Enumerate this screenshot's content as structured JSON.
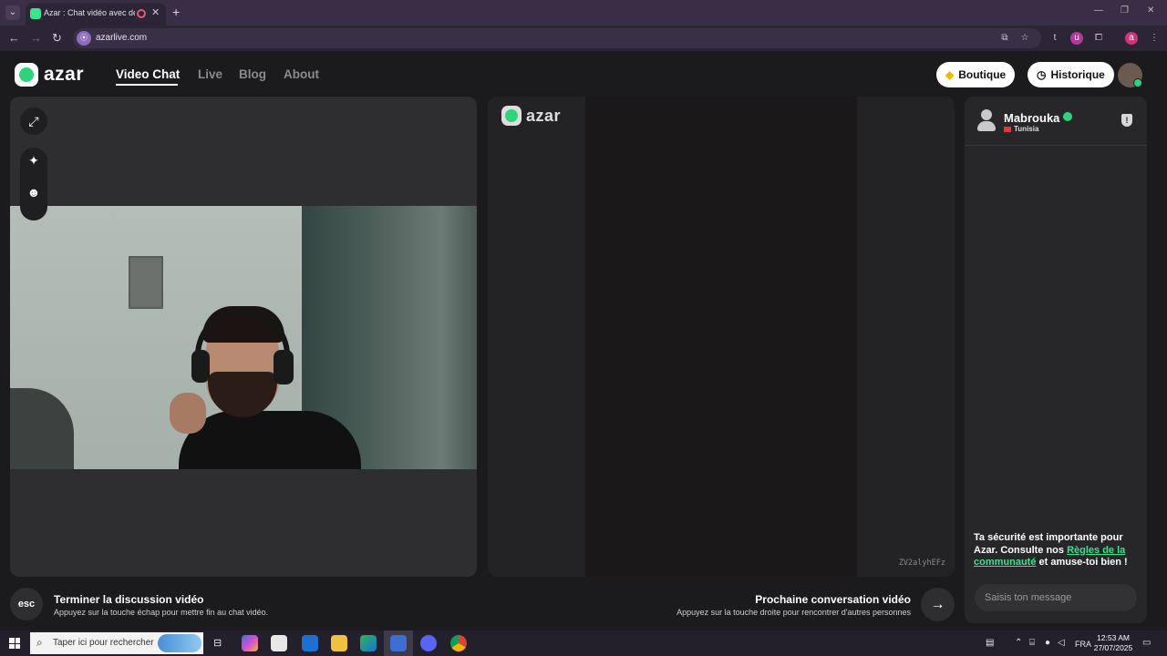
{
  "browser": {
    "tab_title": "Azar : Chat vidéo avec de nouvelles personnes",
    "url": "azarlive.com"
  },
  "site": {
    "logo_text": "azar",
    "nav": [
      {
        "label": "Video Chat"
      },
      {
        "label": "Live"
      },
      {
        "label": "Blog"
      },
      {
        "label": "About"
      }
    ],
    "shop_label": "Boutique",
    "history_label": "Historique"
  },
  "remote": {
    "logo_text": "azar",
    "session_id": "ZV2alyhEFz"
  },
  "peer": {
    "name": "Mabrouka",
    "country": "Tunisia"
  },
  "chat": {
    "safety_pre": "Ta sécurité est importante pour Azar. Consulte nos ",
    "safety_link": "Règles de la communauté",
    "safety_post": " et amuse-toi bien !",
    "input_placeholder": "Saisis ton message"
  },
  "actions": {
    "esc_label": "esc",
    "end_title": "Terminer la discussion vidéo",
    "end_sub": "Appuyez sur la touche échap pour mettre fin au chat vidéo.",
    "next_title": "Prochaine conversation vidéo",
    "next_sub": "Appuyez sur la touche droite pour rencontrer d'autres personnes"
  },
  "taskbar": {
    "search_placeholder": "Taper ici pour rechercher",
    "lang": "FRA",
    "time": "12:53 AM",
    "date": "27/07/2025"
  },
  "colors": {
    "accent": "#2fd37c",
    "link": "#3ce38c",
    "background": "#1b1b1d"
  }
}
